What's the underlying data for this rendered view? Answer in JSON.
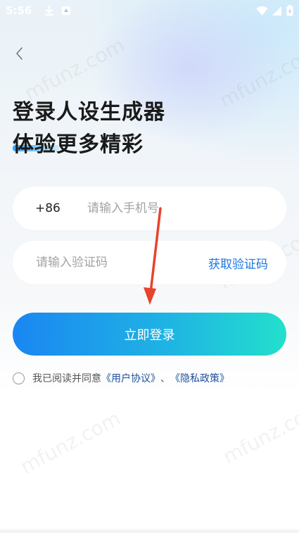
{
  "status_bar": {
    "time": "5:56",
    "icons": [
      "download-icon",
      "notification-icon",
      "wifi-icon",
      "signal-icon",
      "battery-icon"
    ]
  },
  "header": {
    "back_icon": "chevron-left-icon",
    "title_line1": "登录人设生成器",
    "title_line2": "体验更多精彩"
  },
  "form": {
    "country_code": "+86",
    "phone_placeholder": "请输入手机号",
    "code_placeholder": "请输入验证码",
    "get_code_label": "获取验证码",
    "login_label": "立即登录"
  },
  "agreement": {
    "prefix": "我已阅读并同意",
    "user_agreement": "《用户协议》",
    "separator": "、",
    "privacy_policy": "《隐私政策》"
  },
  "watermark": "mfunz.com",
  "colors": {
    "accent": "#1d77e0",
    "button_gradient_start": "#1a86f2",
    "button_gradient_end": "#22e0cc",
    "annotation_arrow": "#e8432e",
    "link": "#1d4f9a"
  }
}
